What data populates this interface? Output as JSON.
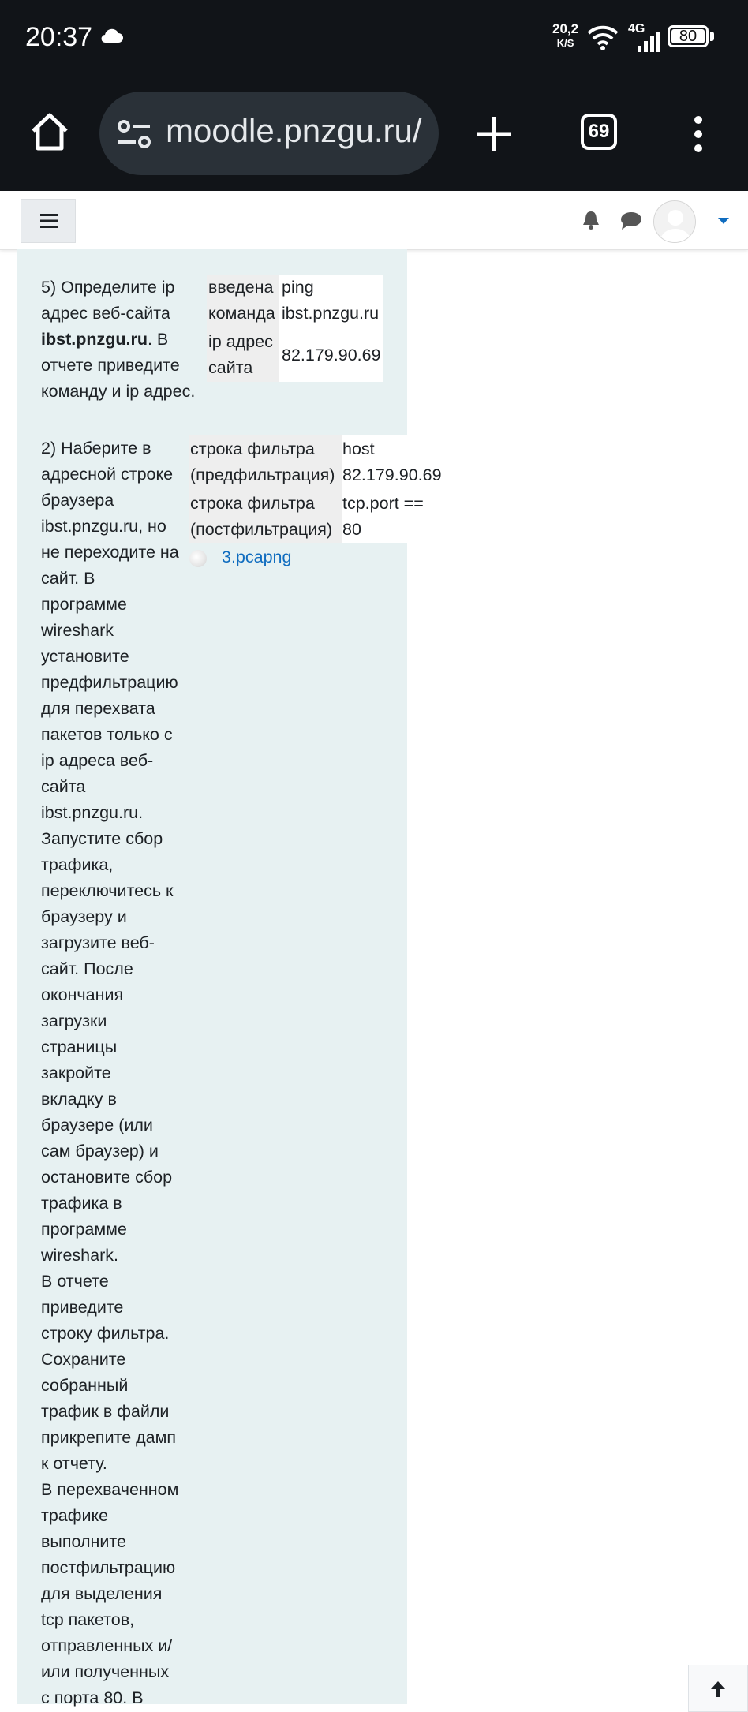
{
  "status_bar": {
    "time": "20:37",
    "speed_value": "20,2",
    "speed_unit": "K/S",
    "network": "4G",
    "battery": "80"
  },
  "browser": {
    "url": "moodle.pnzgu.ru/",
    "tab_count": "69"
  },
  "task5": {
    "lines": [
      "5) Определите ip",
      "адрес веб-сайта"
    ],
    "bold_site": "ibst.pnzgu.ru",
    "after_bold": ". В",
    "lines2": [
      "отчете приведите",
      "команду и ip адрес."
    ],
    "table": {
      "row1_label_1": "введена",
      "row1_label_2": "команда",
      "row1_value_1": "ping",
      "row1_value_2": "ibst.pnzgu.ru",
      "row2_label_1": "ip адрес",
      "row2_label_2": "сайта",
      "row2_value": "82.179.90.69"
    }
  },
  "task2": {
    "lines": [
      "2) Наберите в",
      "адресной строке",
      "браузера",
      "ibst.pnzgu.ru, но",
      "не переходите на",
      "сайт. В",
      "программе",
      "wireshark",
      "установите",
      "предфильтрацию",
      "для перехвата",
      "пакетов только с",
      "ip адреса веб-",
      "сайта",
      "ibst.pnzgu.ru.",
      "Запустите сбор",
      "трафика,",
      "переключитесь к",
      "браузеру и",
      "загрузите веб-",
      "сайт. После",
      "окончания",
      "загрузки",
      "страницы",
      "закройте",
      "вкладку в",
      "браузере (или",
      "сам браузер) и",
      "остановите сбор",
      "трафика в",
      "программе",
      "wireshark.",
      "В отчете",
      "приведите",
      "строку фильтра.",
      "Сохраните",
      "собранный",
      "трафик в файли",
      "прикрепите дамп",
      "к отчету.",
      "В перехваченном",
      "трафике",
      "выполните",
      "постфильтрацию",
      "для выделения",
      "tcp пакетов,",
      "отправленных и/",
      "или полученных",
      "с порта 80. В"
    ],
    "table": {
      "row1_label_1": "строка фильтра",
      "row1_label_2": "(предфильтрация)",
      "row1_value_1": "host",
      "row1_value_2": "82.179.90.69",
      "row2_label_1": "строка фильтра",
      "row2_label_2": "(постфильтрация)",
      "row2_value_1": "tcp.port ==",
      "row2_value_2": "80"
    },
    "attachment": "3.pcapng"
  }
}
